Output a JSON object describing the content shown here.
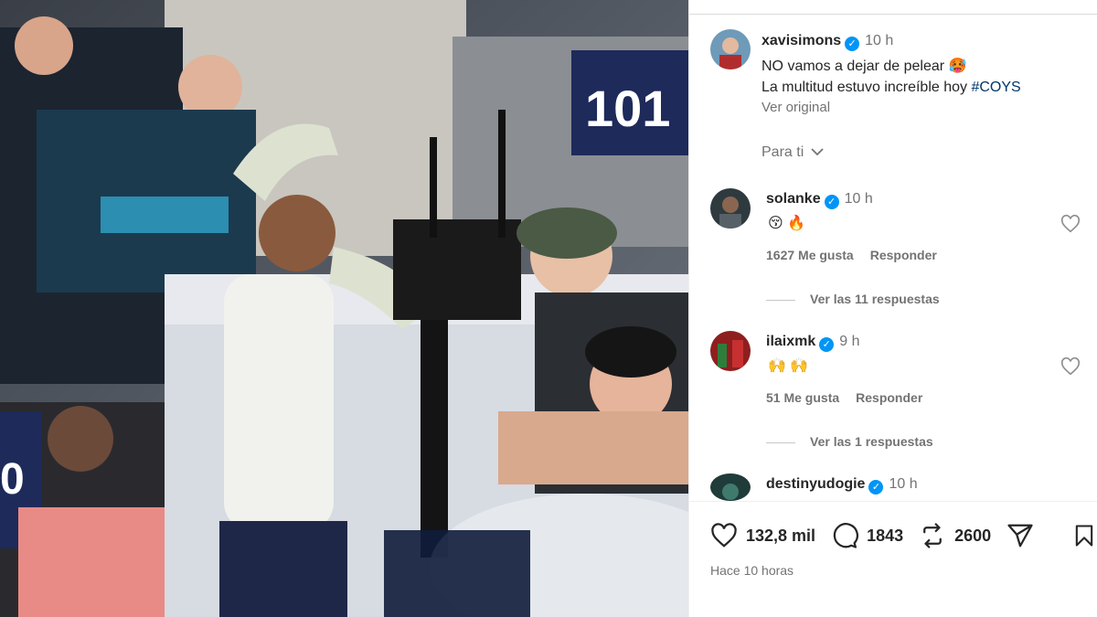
{
  "post": {
    "author": "xavisimons",
    "time": "10 h",
    "caption_line1": "NO vamos a dejar de pelear",
    "caption_emoji": "🥵",
    "caption_line2": "La multitud estuvo increíble hoy",
    "hashtag": "#COYS",
    "see_original": "Ver original",
    "sort_label": "Para ti",
    "photo_sign": "101",
    "photo_sign2": "0"
  },
  "comments": [
    {
      "user": "solanke",
      "time": "10 h",
      "text": "😚 🔥",
      "likes": "1627 Me gusta",
      "reply_label": "Responder",
      "replies": "Ver las 11 respuestas"
    },
    {
      "user": "ilaixmk",
      "time": "9 h",
      "text": "🙌 🙌",
      "likes": "51 Me gusta",
      "reply_label": "Responder",
      "replies": "Ver las 1 respuestas"
    },
    {
      "user": "destinyudogie",
      "time": "10 h"
    }
  ],
  "actions": {
    "likes": "132,8 mil",
    "comments": "1843",
    "reposts": "2600"
  },
  "footer": {
    "posted": "Hace 10 horas"
  },
  "colors": {
    "verified": "#0095f6",
    "hashtag": "#00376b",
    "muted": "#737373"
  },
  "icons": [
    "heart-icon",
    "comment-icon",
    "repost-icon",
    "share-icon",
    "bookmark-icon",
    "chevron-down-icon",
    "verified-icon"
  ]
}
